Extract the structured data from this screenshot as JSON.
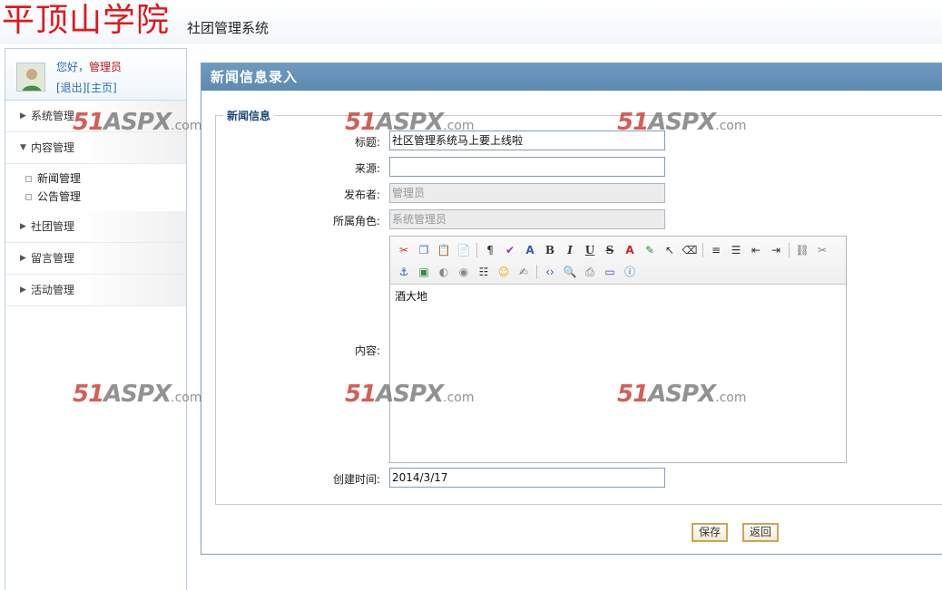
{
  "header": {
    "school_name": "平顶山学院",
    "system_name": "社团管理系统"
  },
  "sidebar": {
    "greeting": "您好，",
    "username": "管理员",
    "logout": "[退出]",
    "home": "[主页]",
    "menus": [
      {
        "label": "系统管理",
        "expanded": false
      },
      {
        "label": "内容管理",
        "expanded": true,
        "items": [
          "新闻管理",
          "公告管理"
        ]
      },
      {
        "label": "社团管理",
        "expanded": false
      },
      {
        "label": "留言管理",
        "expanded": false
      },
      {
        "label": "活动管理",
        "expanded": false
      }
    ]
  },
  "main": {
    "panel_title": "新闻信息录入",
    "legend": "新闻信息",
    "fields": {
      "title_label": "标题:",
      "title_value": "社区管理系统马上要上线啦",
      "source_label": "来源:",
      "source_value": "",
      "publisher_label": "发布者:",
      "publisher_value": "管理员",
      "role_label": "所属角色:",
      "role_value": "系统管理员",
      "content_label": "内容:",
      "content_value": "酒大地",
      "created_label": "创建时间:",
      "created_value": "2014/3/17"
    },
    "buttons": {
      "save": "保存",
      "back": "返回"
    }
  },
  "watermark": {
    "brand_red": "51",
    "brand_gray": "ASPX",
    "suffix": ".com"
  },
  "icons": [
    "cut-icon",
    "copy-icon",
    "paste-icon",
    "paste-text-icon",
    "paragraph-icon",
    "spellcheck-icon",
    "font-size-icon",
    "bold-icon",
    "italic-icon",
    "underline-icon",
    "strikethrough-icon",
    "font-color-icon",
    "highlight-icon",
    "select-icon",
    "eraser-icon",
    "align-left-icon",
    "list-icon",
    "outdent-icon",
    "indent-icon",
    "link-icon",
    "unlink-icon",
    "anchor-icon",
    "image-icon",
    "flash-icon",
    "media-icon",
    "hr-icon",
    "emoticon-icon",
    "form-icon",
    "source-code-icon",
    "preview-icon",
    "print-icon",
    "fullscreen-icon",
    "about-icon"
  ]
}
